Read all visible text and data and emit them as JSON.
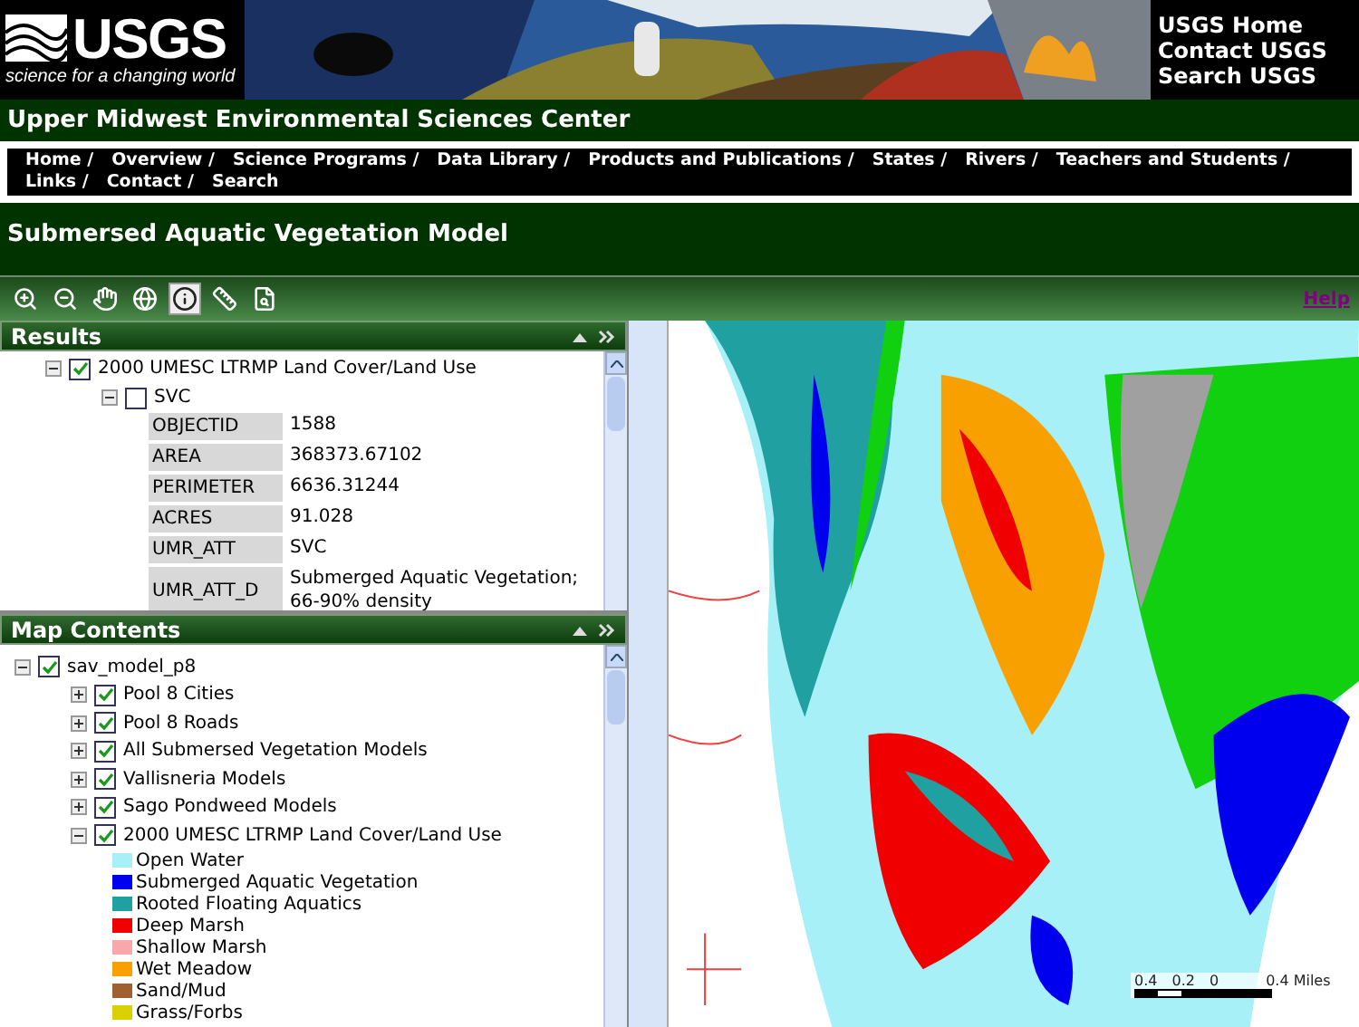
{
  "header": {
    "logo": {
      "wordmark": "USGS",
      "tagline": "science for a changing world"
    },
    "banner": {
      "kind": "picture"
    },
    "links": [
      "USGS Home",
      "Contact USGS",
      "Search USGS"
    ]
  },
  "center_title": "Upper Midwest Environmental Sciences Center",
  "nav": [
    "Home /",
    "Overview /",
    "Science Programs /",
    "Data Library /",
    "Products and Publications /",
    "States /",
    "Rivers /",
    "Teachers and Students /",
    "Links /",
    "Contact /",
    "Search"
  ],
  "page_title": "Submersed Aquatic Vegetation Model",
  "toolbar": {
    "tools": [
      {
        "kind": "zoom-in",
        "selected": false
      },
      {
        "kind": "zoom-out",
        "selected": false
      },
      {
        "kind": "pan",
        "selected": false
      },
      {
        "kind": "full-extent",
        "selected": false
      },
      {
        "kind": "identify",
        "selected": true
      },
      {
        "kind": "measure",
        "selected": false
      },
      {
        "kind": "zoom-layer",
        "selected": false
      }
    ],
    "help": "Help"
  },
  "results": {
    "title": "Results",
    "tree": [
      {
        "label": "2000 UMESC LTRMP Land Cover/Land Use",
        "checked": true,
        "expanded": true,
        "children": [
          {
            "label": "SVC",
            "checked": false,
            "expanded": true,
            "attributes": [
              {
                "name": "OBJECTID",
                "value": "1588"
              },
              {
                "name": "AREA",
                "value": "368373.67102"
              },
              {
                "name": "PERIMETER",
                "value": "6636.31244"
              },
              {
                "name": "ACRES",
                "value": "91.028"
              },
              {
                "name": "UMR_ATT",
                "value": "SVC"
              },
              {
                "name": "UMR_ATT_D",
                "value": "Submerged Aquatic Vegetation; 66-90% density"
              }
            ]
          }
        ]
      }
    ]
  },
  "map_contents": {
    "title": "Map Contents",
    "tree": [
      {
        "label": "sav_model_p8",
        "checked": true,
        "expanded": true,
        "children": [
          {
            "label": "Pool 8 Cities",
            "checked": true,
            "expanded": false
          },
          {
            "label": "Pool 8 Roads",
            "checked": true,
            "expanded": false
          },
          {
            "label": "All Submersed Vegetation Models",
            "checked": true,
            "expanded": false
          },
          {
            "label": "Vallisneria Models",
            "checked": true,
            "expanded": false
          },
          {
            "label": "Sago Pondweed Models",
            "checked": true,
            "expanded": false
          },
          {
            "label": "2000 UMESC LTRMP Land Cover/Land Use",
            "checked": true,
            "expanded": true,
            "legend": [
              {
                "label": "Open Water",
                "color": "#a8f0f8"
              },
              {
                "label": "Submerged Aquatic Vegetation",
                "color": "#0000ee"
              },
              {
                "label": "Rooted Floating Aquatics",
                "color": "#20a0a0"
              },
              {
                "label": "Deep Marsh",
                "color": "#f00000"
              },
              {
                "label": "Shallow Marsh",
                "color": "#f8a8a8"
              },
              {
                "label": "Wet Meadow",
                "color": "#f8a000"
              },
              {
                "label": "Sand/Mud",
                "color": "#a06030"
              },
              {
                "label": "Grass/Forbs",
                "color": "#d8d000"
              }
            ]
          }
        ]
      }
    ]
  },
  "map": {
    "scale_labels": [
      "0.4",
      "0.2",
      "0",
      "0.4 Miles"
    ]
  }
}
